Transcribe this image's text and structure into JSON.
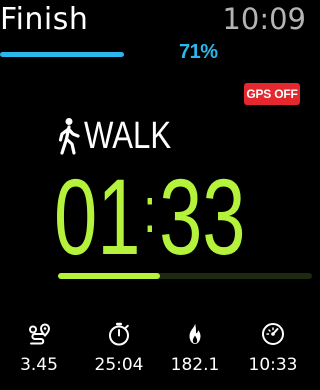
{
  "header": {
    "finish_label": "Finish",
    "time": "10:09"
  },
  "progress": {
    "percent_label": "71%",
    "fraction": 0.71,
    "color": "#2ab7ec"
  },
  "gps": {
    "label": "GPS OFF",
    "color": "#e5272e"
  },
  "activity": {
    "mode_label": "WALK",
    "mode_icon": "walking-person-icon",
    "timer_minutes": "01",
    "timer_separator": ":",
    "timer_seconds": "33",
    "timer_color": "#b5f23b",
    "lap_fraction": 0.4,
    "lap_track_color": "#1d2a0e"
  },
  "stats": [
    {
      "icon": "route-distance-icon",
      "value": "3.45"
    },
    {
      "icon": "stopwatch-icon",
      "value": "25:04"
    },
    {
      "icon": "flame-icon",
      "value": "182.1"
    },
    {
      "icon": "speedometer-icon",
      "value": "10:33"
    }
  ]
}
